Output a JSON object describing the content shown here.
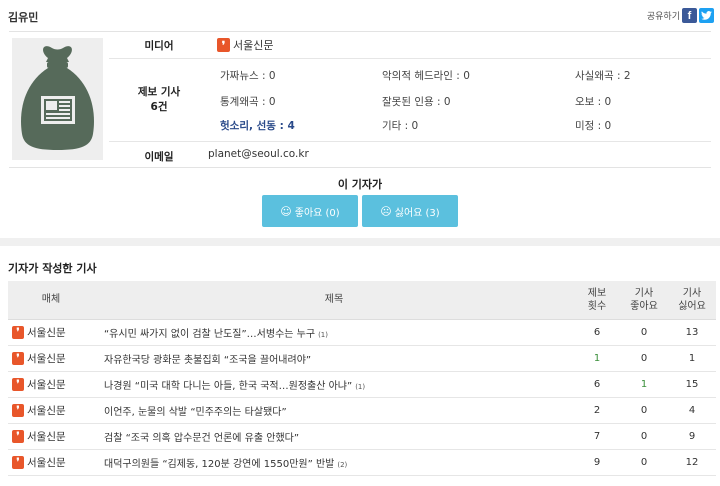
{
  "reporter": {
    "name": "김유민"
  },
  "share": {
    "label": "공유하기",
    "facebook": "f",
    "twitter": "t"
  },
  "info": {
    "media_label": "미디어",
    "media_name": "서울신문",
    "tips_label_1": "제보 기사",
    "tips_label_2": "6건",
    "email_label": "이메일",
    "email": "planet@seoul.co.kr",
    "stats": [
      {
        "label": "가짜뉴스",
        "value": "0"
      },
      {
        "label": "악의적 헤드라인",
        "value": "0"
      },
      {
        "label": "사실왜곡",
        "value": "2"
      },
      {
        "label": "통계왜곡",
        "value": "0"
      },
      {
        "label": "잘못된 인용",
        "value": "0"
      },
      {
        "label": "오보",
        "value": "0"
      },
      {
        "label": "헛소리, 선동",
        "value": "4"
      },
      {
        "label": "기타",
        "value": "0"
      },
      {
        "label": "미정",
        "value": "0"
      }
    ]
  },
  "reaction": {
    "title": "이 기자가",
    "like_label": "좋아요 (0)",
    "dislike_label": "싫어요 (3)"
  },
  "articles": {
    "section_title": "기자가 작성한 기사",
    "headers": {
      "media": "매체",
      "title": "제목",
      "tips_1": "제보",
      "tips_2": "횟수",
      "like_1": "기사",
      "like_2": "좋아요",
      "dislike_1": "기사",
      "dislike_2": "싫어요"
    },
    "rows": [
      {
        "media": "서울신문",
        "title": "“유시민 싸가지 없이 검찰 난도질”…서병수는 누구",
        "count": "(1)",
        "tips": "6",
        "like": "0",
        "dislike": "13"
      },
      {
        "media": "서울신문",
        "title": "자유한국당 광화문 촛불집회 “조국을 끌어내려야”",
        "count": "",
        "tips": "1",
        "like": "0",
        "dislike": "1"
      },
      {
        "media": "서울신문",
        "title": "나경원 “미국 대학 다니는 아들, 한국 국적…원정출산 아냐”",
        "count": "(1)",
        "tips": "6",
        "like": "1",
        "dislike": "15"
      },
      {
        "media": "서울신문",
        "title": "이언주, 눈물의 삭발 “민주주의는 타살됐다”",
        "count": "",
        "tips": "2",
        "like": "0",
        "dislike": "4"
      },
      {
        "media": "서울신문",
        "title": "검찰 “조국 의혹 압수문건 언론에 유출 안했다”",
        "count": "",
        "tips": "7",
        "like": "0",
        "dislike": "9"
      },
      {
        "media": "서울신문",
        "title": "대덕구의원들 “김제동, 120분 강연에 1550만원” 반발",
        "count": "(2)",
        "tips": "9",
        "like": "0",
        "dislike": "12"
      }
    ]
  }
}
